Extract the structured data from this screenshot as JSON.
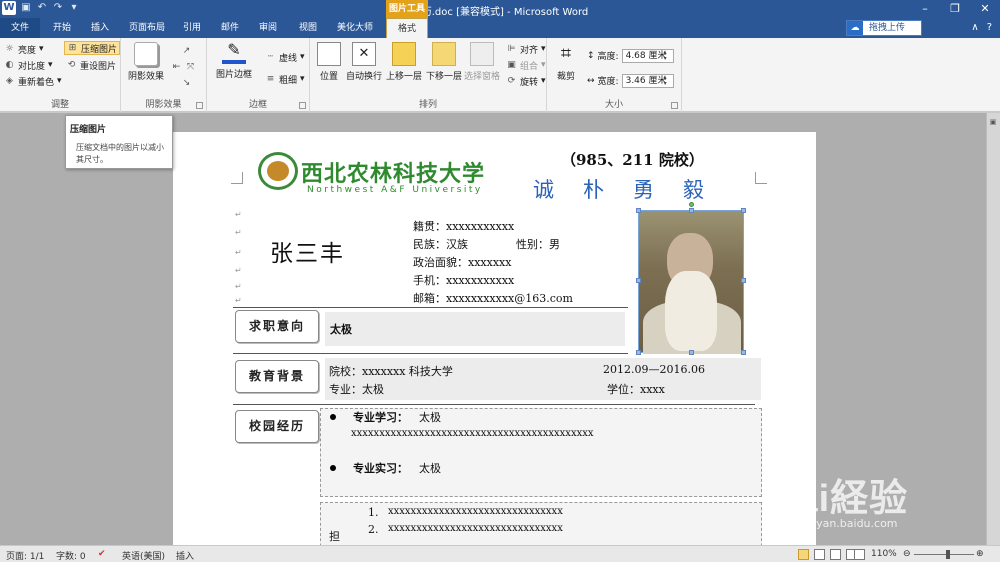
{
  "titlebar": {
    "title": "简历.doc [兼容模式] - Microsoft Word",
    "logo": "W",
    "tools_tab": "图片工具"
  },
  "tabs": [
    "文件",
    "开始",
    "插入",
    "页面布局",
    "引用",
    "邮件",
    "审阅",
    "视图",
    "美化大师",
    "格式"
  ],
  "upload_label": "拖拽上传",
  "ribbon": {
    "adjust": {
      "label": "调整",
      "brightness": "亮度",
      "contrast": "对比度",
      "recolor": "重新着色",
      "compress": "压缩图片",
      "reset": "重设图片"
    },
    "shadow": {
      "label": "阴影效果",
      "shadow_btn": "阴影效果"
    },
    "border": {
      "label": "边框",
      "picture_border": "图片边框",
      "dash": "虚线",
      "weight": "粗细"
    },
    "arrange": {
      "label": "排列",
      "position": "位置",
      "wrap": "自动换行",
      "forward": "上移一层",
      "backward": "下移一层",
      "selection": "选择窗格",
      "align": "对齐",
      "group": "组合",
      "rotate": "旋转"
    },
    "size": {
      "label": "大小",
      "crop": "裁剪",
      "height_label": "高度:",
      "height_value": "4.68 厘米",
      "width_label": "宽度:",
      "width_value": "3.46 厘米"
    }
  },
  "tooltip": {
    "title": "压缩图片",
    "body": "压缩文档中的图片以减小其尺寸。"
  },
  "document": {
    "university_cn": "西北农林科技大学",
    "university_en": "Northwest A&F University",
    "rank": "（985、211 院校）",
    "motto": "诚朴勇毅",
    "name": "张三丰",
    "native": "籍贯：xxxxxxxxxxx",
    "ethnic": "民族：汉族",
    "gender": "性别：男",
    "political": "政治面貌：xxxxxxx",
    "phone": "手机：xxxxxxxxxxx",
    "email": "邮箱：xxxxxxxxxxx@163.com",
    "sections": {
      "objective_label": "求职意向",
      "objective_value": "太极",
      "education_label": "教育背景",
      "school": "院校：xxxxxxx 科技大学",
      "period": "2012.09—2016.06",
      "major": "专业：太极",
      "degree": "学位：xxxx",
      "campus_label": "校园经历",
      "study_label": "专业学习：",
      "study_value": "太极",
      "study_detail": "xxxxxxxxxxxxxxxxxxxxxxxxxxxxxxxxxxxxxxxxxxx",
      "practice_label": "专业实习：",
      "practice_value": "太极",
      "list_1_num": "1.",
      "list_1": "xxxxxxxxxxxxxxxxxxxxxxxxxxxxxxx",
      "list_2_num": "2.",
      "list_2": "xxxxxxxxxxxxxxxxxxxxxxxxxxxxxxx",
      "list_side": "担"
    }
  },
  "statusbar": {
    "page": "页面: 1/1",
    "words": "字数: 0",
    "language": "英语(美国)",
    "mode": "插入",
    "zoom": "110%"
  },
  "watermark": {
    "text": "Bai経验",
    "url": "jingyan.baidu.com"
  },
  "colors": {
    "title_bg": "#2b5797",
    "tools_tab": "#e3a21a",
    "university_green": "#2f8a2f",
    "motto_blue": "#2b63b8"
  }
}
